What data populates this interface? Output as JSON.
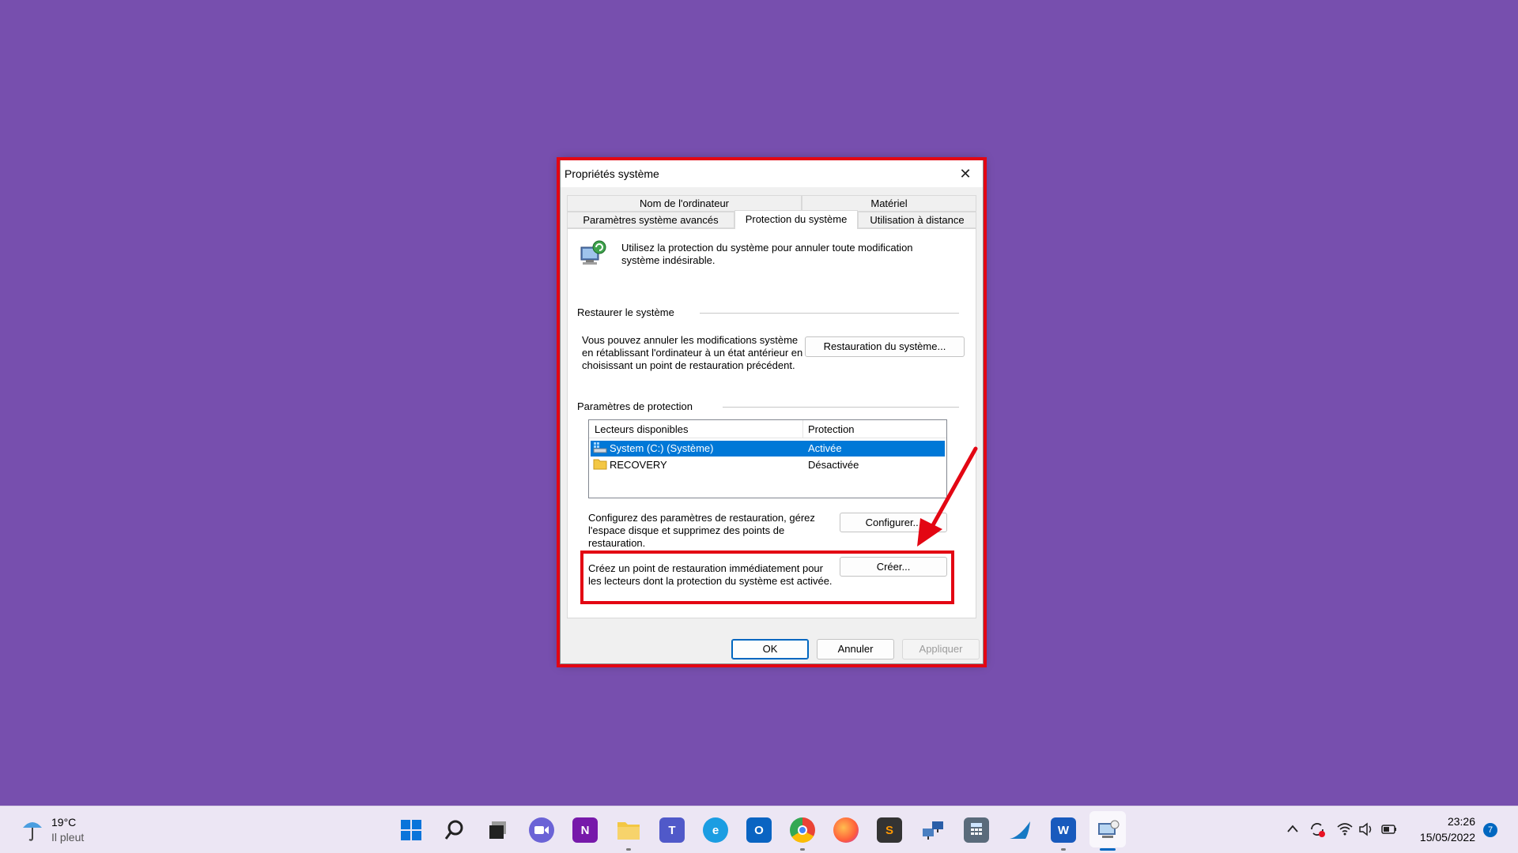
{
  "window": {
    "title": "Propriétés système",
    "close_glyph": "✕",
    "tabs_top": [
      "Nom de l'ordinateur",
      "Matériel"
    ],
    "tabs_bottom": [
      "Paramètres système avancés",
      "Protection du système",
      "Utilisation à distance"
    ],
    "active_tab": "Protection du système"
  },
  "intro": {
    "text": "Utilisez la protection du système pour annuler toute modification système indésirable."
  },
  "restore": {
    "group_label": "Restaurer le système",
    "description": "Vous pouvez annuler les modifications système en rétablissant l'ordinateur à un état antérieur en choisissant un point de restauration précédent.",
    "button": "Restauration du système..."
  },
  "protection": {
    "group_label": "Paramètres de protection",
    "columns": [
      "Lecteurs disponibles",
      "Protection"
    ],
    "drives": [
      {
        "name": "System (C:) (Système)",
        "status": "Activée",
        "selected": true,
        "icon": "drive-icon"
      },
      {
        "name": "RECOVERY",
        "status": "Désactivée",
        "selected": false,
        "icon": "folder-icon"
      }
    ],
    "configure_text": "Configurez des paramètres de restauration, gérez l'espace disque et supprimez des points de restauration.",
    "configure_button": "Configurer...",
    "create_text": "Créez un point de restauration immédiatement pour les lecteurs dont la protection du système est activée.",
    "create_button": "Créer..."
  },
  "footer": {
    "ok": "OK",
    "cancel": "Annuler",
    "apply": "Appliquer"
  },
  "taskbar": {
    "weather_temp": "19°C",
    "weather_desc": "Il pleut",
    "time": "23:26",
    "date": "15/05/2022",
    "notification_count": "7",
    "apps": [
      "start-icon",
      "search-icon",
      "task-view-icon",
      "chat-icon",
      "onenote-icon",
      "file-explorer-icon",
      "teams-icon",
      "edge-icon",
      "outlook-icon",
      "chrome-icon",
      "firefox-icon",
      "sublime-icon",
      "network-icon",
      "calculator-icon",
      "wireshark-icon",
      "word-icon",
      "system-properties-icon"
    ]
  },
  "colors": {
    "desktop": "#774fae",
    "annotation": "#e30613",
    "selection": "#0078d7"
  }
}
